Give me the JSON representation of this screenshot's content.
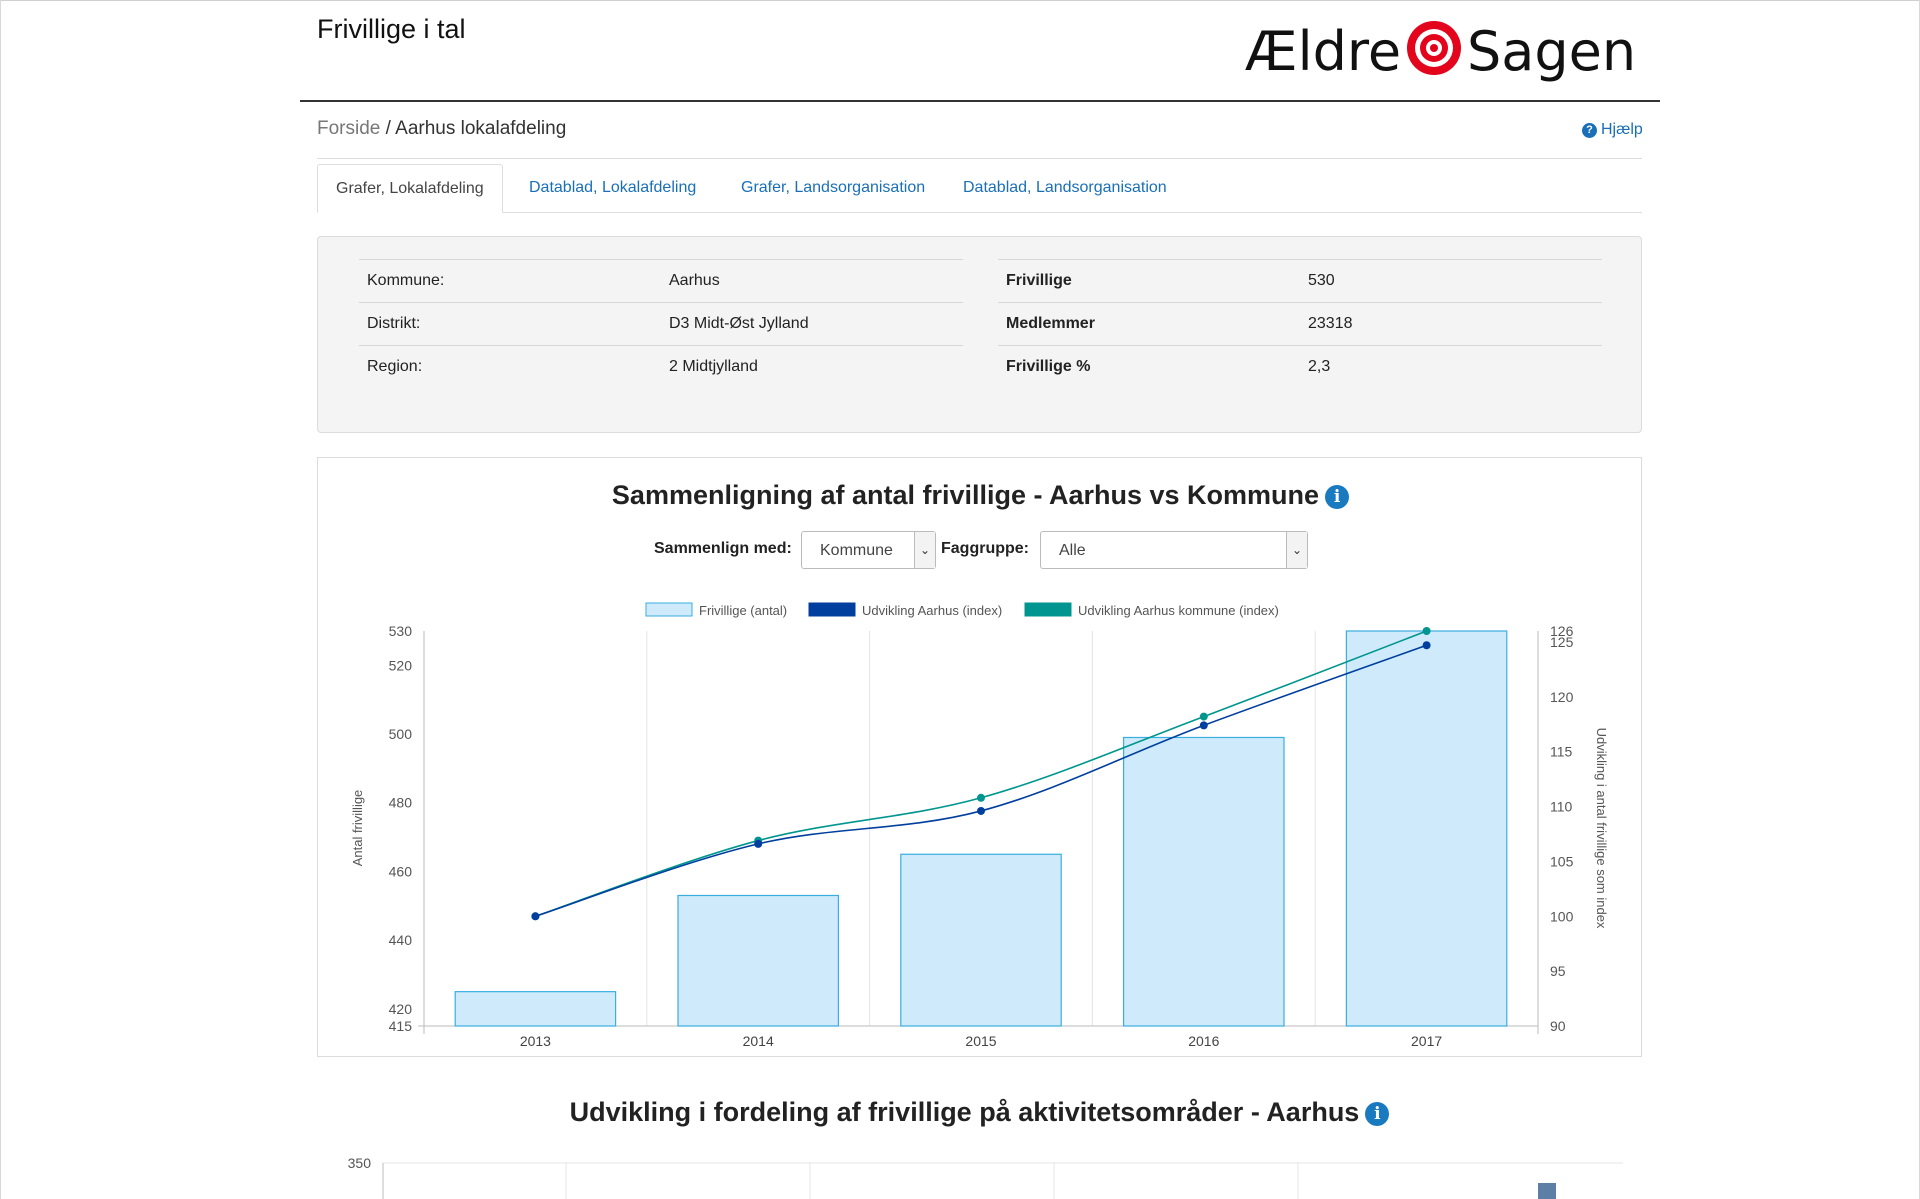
{
  "app": {
    "title": "Frivillige i tal",
    "logo_text_left": "Ældre",
    "logo_text_right": "Sagen"
  },
  "breadcrumb": {
    "home": "Forside",
    "separator": " / ",
    "current": "Aarhus lokalafdeling"
  },
  "help": {
    "label": "Hjælp",
    "icon": "question-circle-icon"
  },
  "tabs": [
    {
      "label": "Grafer, Lokalafdeling",
      "active": true
    },
    {
      "label": "Datablad, Lokalafdeling",
      "active": false
    },
    {
      "label": "Grafer, Landsorganisation",
      "active": false
    },
    {
      "label": "Datablad, Landsorganisation",
      "active": false
    }
  ],
  "info": {
    "left": [
      {
        "key": "Kommune:",
        "value": "Aarhus"
      },
      {
        "key": "Distrikt:",
        "value": "D3 Midt-Øst Jylland"
      },
      {
        "key": "Region:",
        "value": "2 Midtjylland"
      }
    ],
    "right": [
      {
        "key": "Frivillige",
        "value": "530"
      },
      {
        "key": "Medlemmer",
        "value": "23318"
      },
      {
        "key": "Frivillige %",
        "value": "2,3"
      }
    ]
  },
  "chart1_panel": {
    "title": "Sammenligning af antal frivillige - Aarhus vs Kommune",
    "compare_label": "Sammenlign med:",
    "compare_value": "Kommune",
    "group_label": "Faggruppe:",
    "group_value": "Alle"
  },
  "chart2_panel": {
    "title": "Udvikling i fordeling af frivillige på aktivitetsområder - Aarhus"
  },
  "colors": {
    "link": "#1a6fb8",
    "bar_fill": "#cfeafb",
    "bar_stroke": "#3aaee0",
    "aarhus_line": "#003f9e",
    "kommune_line": "#00968f",
    "logo_red": "#e3051b"
  },
  "chart_data": [
    {
      "type": "bar",
      "title": "Sammenligning af antal frivillige - Aarhus vs Kommune",
      "categories": [
        "2013",
        "2014",
        "2015",
        "2016",
        "2017"
      ],
      "ylabel": "Antal frivillige",
      "y2label": "Udvikling i antal frivillige som index",
      "ylim": [
        415,
        530
      ],
      "yticks": [
        415,
        420,
        440,
        460,
        480,
        500,
        520,
        530
      ],
      "y2lim": [
        90,
        126
      ],
      "y2ticks": [
        90,
        95,
        100,
        105,
        110,
        115,
        120,
        125,
        126
      ],
      "grid": true,
      "legend_position": "top",
      "series": [
        {
          "name": "Frivillige (antal)",
          "kind": "bar",
          "axis": "left",
          "values": [
            425,
            453,
            465,
            499,
            530
          ]
        },
        {
          "name": "Udvikling Aarhus (index)",
          "kind": "line",
          "axis": "right",
          "values": [
            100,
            106.6,
            109.6,
            117.4,
            124.7
          ]
        },
        {
          "name": "Udvikling Aarhus kommune (index)",
          "kind": "line",
          "axis": "right",
          "values": [
            100,
            106.9,
            110.8,
            118.2,
            126
          ]
        }
      ]
    },
    {
      "type": "bar",
      "title": "Udvikling i fordeling af frivillige på aktivitetsområder - Aarhus",
      "yticks": [
        350
      ]
    }
  ]
}
